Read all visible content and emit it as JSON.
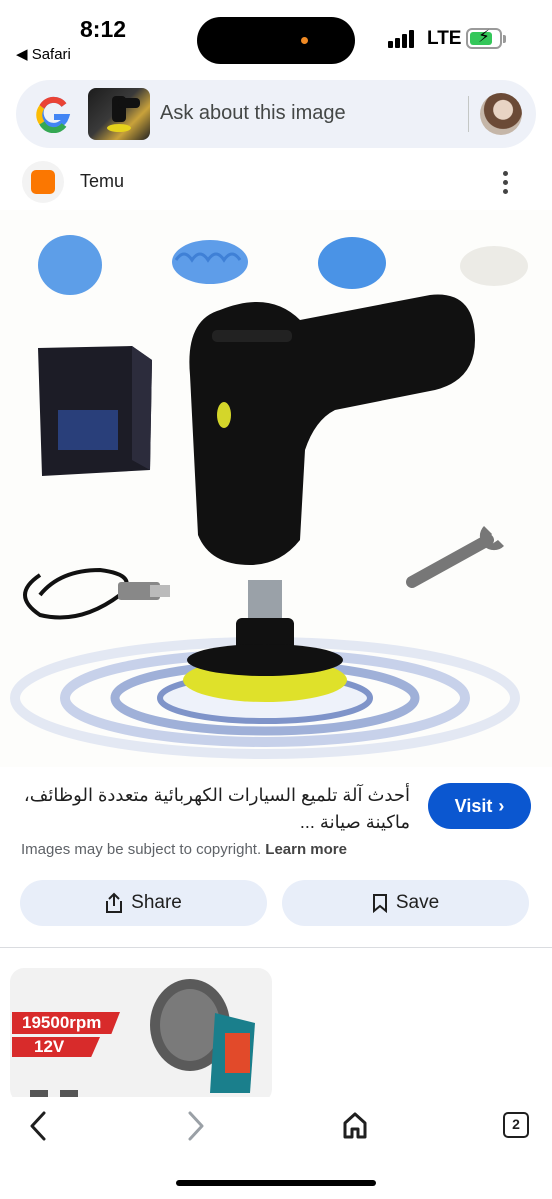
{
  "status_bar": {
    "time": "8:12",
    "back_app": "◀ Safari",
    "network": "LTE",
    "signal_icon": "cellular-signal-icon",
    "battery_icon": "battery-charging-icon"
  },
  "lens_bar": {
    "placeholder": "Ask about this image",
    "logo_icon": "google-lens-logo-icon"
  },
  "source": {
    "name": "Temu",
    "logo_text": "TEMU",
    "more_icon": "more-vertical-icon"
  },
  "result": {
    "caption": "أحدث آلة تلميع السيارات الكهربائية متعددة الوظائف، ماكينة صيانة ...",
    "visit_label": "Visit",
    "copyright_text": "Images may be subject to copyright.",
    "learn_more": "Learn more",
    "share_label": "Share",
    "save_label": "Save"
  },
  "related": {
    "rpm_tag": "19500rpm",
    "volt_tag": "12V"
  },
  "toolbar": {
    "tabs_count": "2"
  },
  "colors": {
    "accent": "#0b57d0",
    "chip_bg": "#e8eef9",
    "temu_orange": "#fb7701",
    "tag_red": "#d82b2b"
  }
}
